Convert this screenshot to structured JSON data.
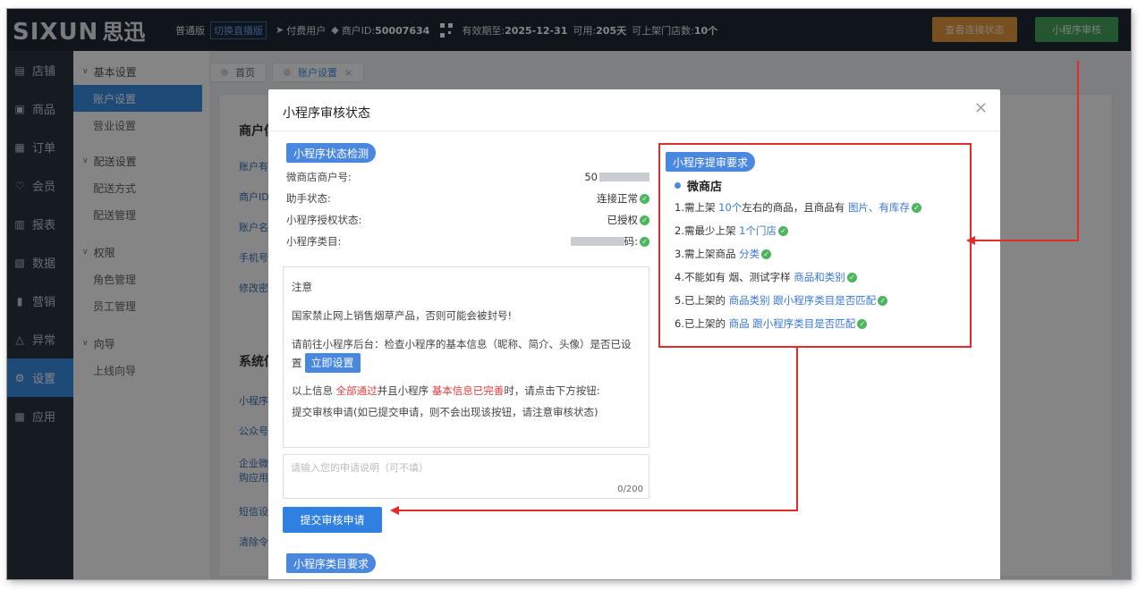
{
  "topbar": {
    "logo_en": "SIXUN",
    "logo_cn": "思迅",
    "edition": "普通版",
    "switch_label": "切换直播版",
    "user_type": "付费用户",
    "merchant_label": "商户ID:",
    "merchant_id": "50007634",
    "expiry_label": "有效期至:",
    "expiry": "2025-12-31",
    "available_label": "可用:",
    "available_days": "205天",
    "stores_label": "可上架门店数:",
    "stores": "10个",
    "check_connection": "查看连接状态",
    "audit_button": "小程序审核"
  },
  "leftnav": [
    {
      "label": "店铺",
      "icon": "store-icon",
      "glyph": "▤"
    },
    {
      "label": "商品",
      "icon": "gift-icon",
      "glyph": "▣"
    },
    {
      "label": "订单",
      "icon": "order-icon",
      "glyph": "▦"
    },
    {
      "label": "会员",
      "icon": "member-icon",
      "glyph": "♡"
    },
    {
      "label": "报表",
      "icon": "report-icon",
      "glyph": "▥"
    },
    {
      "label": "数据",
      "icon": "data-icon",
      "glyph": "▧"
    },
    {
      "label": "营销",
      "icon": "marketing-icon",
      "glyph": "▮"
    },
    {
      "label": "异常",
      "icon": "warning-icon",
      "glyph": "△"
    },
    {
      "label": "设置",
      "icon": "gear-icon",
      "glyph": "⚙"
    },
    {
      "label": "应用",
      "icon": "apps-icon",
      "glyph": "▩"
    }
  ],
  "subnav": {
    "group_basic": "基本设置",
    "account": "账户设置",
    "business": "营业设置",
    "group_delivery": "配送设置",
    "delivery_method": "配送方式",
    "delivery_manage": "配送管理",
    "group_perm": "权限",
    "role_manage": "角色管理",
    "staff_manage": "员工管理",
    "group_guide": "向导",
    "online_guide": "上线向导"
  },
  "tabs": {
    "home": "首页",
    "account": "账户设置",
    "close": "×"
  },
  "bgpage": {
    "merchant_title": "商户信",
    "f1": "账户有",
    "f2": "商户ID",
    "f3": "账户名",
    "f4": "手机号",
    "f5": "修改密",
    "system_title": "系统信",
    "s1": "小程序",
    "s2": "公众号",
    "s3a": "企业微",
    "s3b": "购应用",
    "s4": "短信设",
    "s5": "清除令"
  },
  "modal": {
    "title": "小程序审核状态",
    "close": "×",
    "status_section": "小程序状态检测",
    "rows": [
      {
        "label": "微商店商户号:",
        "value": "50",
        "blur": true,
        "ok": false
      },
      {
        "label": "助手状态:",
        "value": "连接正常",
        "blur": false,
        "ok": true
      },
      {
        "label": "小程序授权状态:",
        "value": "已授权",
        "blur": false,
        "ok": true
      },
      {
        "label": "小程序类目:",
        "value": "码:",
        "blur": true,
        "ok": true
      }
    ],
    "notice_title": "注意",
    "notice_warning": "国家禁止网上销售烟草产品，否则可能会被封号!",
    "notice_go": "请前往小程序后台：检查小程序的基本信息（昵称、简介、头像）是否已设置",
    "set_now": "立即设置",
    "notice_line3_a": "以上信息",
    "notice_line3_b": "全部通过",
    "notice_line3_c": "并且小程序",
    "notice_line3_d": "基本信息已完善",
    "notice_line3_e": "时，请点击下方按钮:",
    "notice_line4": "提交审核申请(如已提交申请，则不会出现该按钮，请注意审核状态)",
    "textarea_placeholder": "请输入您的申请说明（可不填）",
    "textarea_count": "0/200",
    "submit": "提交审核申请",
    "category_section": "小程序类目要求",
    "req_section": "小程序提审要求",
    "req_head": "微商店",
    "req1_a": "1.需上架",
    "req1_b": "10个",
    "req1_c": "左右的商品，且商品有",
    "req1_d": "图片、有库存",
    "req2_a": "2.需最少上架",
    "req2_b": "1个门店",
    "req3_a": "3.需上架商品",
    "req3_b": "分类",
    "req4_a": "4.不能如有 烟、测试字样",
    "req4_b": "商品和类别",
    "req5_a": "5.已上架的",
    "req5_b": "商品类别 跟小程序类目是否匹配",
    "req6_a": "6.已上架的",
    "req6_b": "商品 跟小程序类目是否匹配"
  },
  "colors": {
    "topbar": "#1f2a36",
    "accent": "#3a8ee6",
    "orange": "#e6973a",
    "green": "#46a65a",
    "annotation_red": "#e22c2c"
  }
}
